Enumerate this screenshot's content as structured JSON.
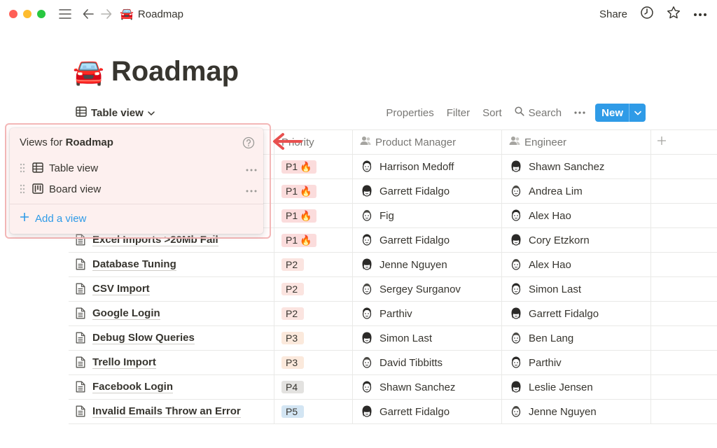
{
  "window": {
    "breadcrumb_emoji": "🚘",
    "breadcrumb": "Roadmap",
    "share_label": "Share"
  },
  "page": {
    "emoji": "🚘",
    "title": "Roadmap"
  },
  "toolbar": {
    "view_label": "Table view",
    "properties": "Properties",
    "filter": "Filter",
    "sort": "Sort",
    "search": "Search",
    "new_label": "New"
  },
  "table": {
    "columns": [
      "Priority",
      "Product Manager",
      "Engineer"
    ],
    "rows": [
      {
        "name": "",
        "priority": "P1",
        "fire": "🔥",
        "pm": "Harrison Medoff",
        "eng": "Shawn Sanchez"
      },
      {
        "name": "",
        "priority": "P1",
        "fire": "🔥",
        "pm": "Garrett Fidalgo",
        "eng": "Andrea Lim"
      },
      {
        "name": "",
        "priority": "P1",
        "fire": "🔥",
        "pm": "Fig",
        "eng": "Alex Hao"
      },
      {
        "name": "Excel Imports >20Mb Fail",
        "priority": "P1",
        "fire": "🔥",
        "pm": "Garrett Fidalgo",
        "eng": "Cory Etzkorn"
      },
      {
        "name": "Database Tuning",
        "priority": "P2",
        "fire": "",
        "pm": "Jenne Nguyen",
        "eng": "Alex Hao"
      },
      {
        "name": "CSV Import",
        "priority": "P2",
        "fire": "",
        "pm": "Sergey Surganov",
        "eng": "Simon Last"
      },
      {
        "name": "Google Login",
        "priority": "P2",
        "fire": "",
        "pm": "Parthiv",
        "eng": "Garrett Fidalgo"
      },
      {
        "name": "Debug Slow Queries",
        "priority": "P3",
        "fire": "",
        "pm": "Simon Last",
        "eng": "Ben Lang"
      },
      {
        "name": "Trello Import",
        "priority": "P3",
        "fire": "",
        "pm": "David Tibbitts",
        "eng": "Parthiv"
      },
      {
        "name": "Facebook Login",
        "priority": "P4",
        "fire": "",
        "pm": "Shawn Sanchez",
        "eng": "Leslie Jensen"
      },
      {
        "name": "Invalid Emails Throw an Error",
        "priority": "P5",
        "fire": "",
        "pm": "Garrett Fidalgo",
        "eng": "Jenne Nguyen"
      }
    ]
  },
  "priority_colors": {
    "P1": "#fbdcdc",
    "P2": "#fbe4e0",
    "P3": "#fbe9dc",
    "P4": "#e3e2e0",
    "P5": "#d3e5f3"
  },
  "views_menu": {
    "heading_prefix": "Views for",
    "heading_db": "Roadmap",
    "items": [
      "Table view",
      "Board view"
    ],
    "add_label": "Add a view"
  }
}
